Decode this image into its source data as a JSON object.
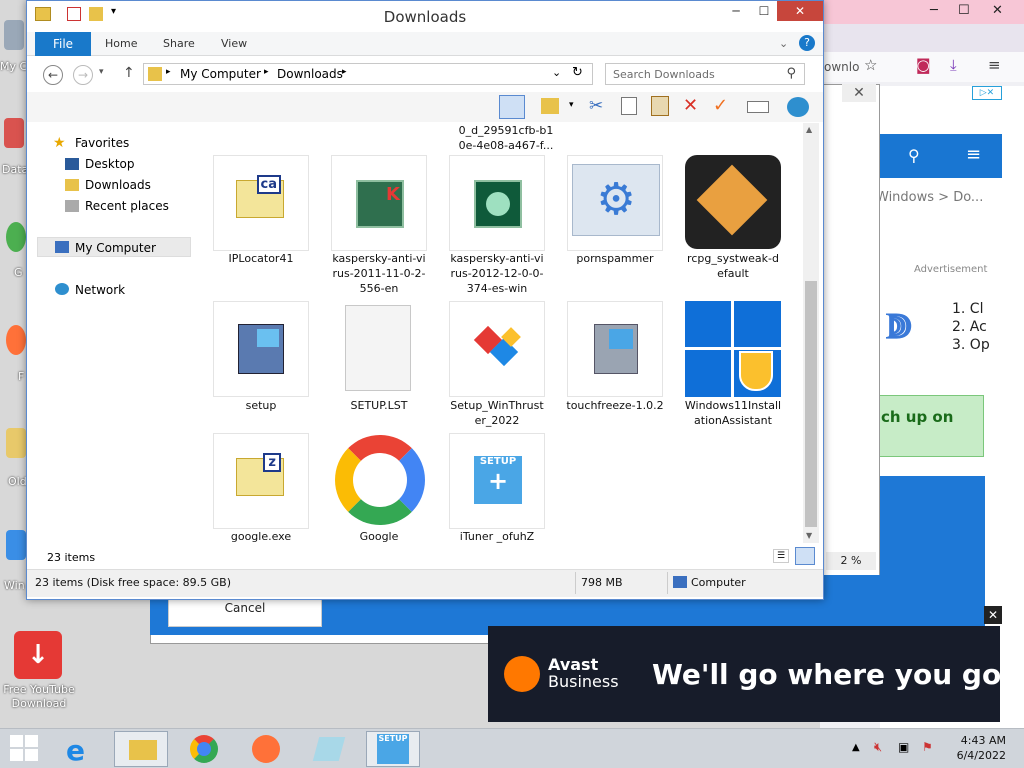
{
  "desktop": {
    "items": [
      "My C",
      "Data",
      "G\nG",
      "F",
      "Old",
      "Win"
    ],
    "youtube_label": "Free YouTube Download"
  },
  "firefox": {
    "url_fragment": "ownlo",
    "breadcrumb": "Windows > Do...",
    "ad_label": "Advertisement",
    "steps": [
      "1. Cl",
      "2. Ac",
      "3. Op"
    ],
    "green_text": "ch up on"
  },
  "dialog": {
    "cancel_label": "Cancel",
    "percent": "2 %"
  },
  "avast": {
    "brand_line1": "Avast",
    "brand_line2": "Business",
    "tagline": "We'll go where you go"
  },
  "explorer": {
    "title": "Downloads",
    "tabs": [
      "File",
      "Home",
      "Share",
      "View"
    ],
    "address": [
      "My Computer",
      "Downloads"
    ],
    "search_placeholder": "Search Downloads",
    "nav": {
      "favorites": "Favorites",
      "desktop": "Desktop",
      "downloads": "Downloads",
      "recent": "Recent places",
      "mycomputer": "My Computer",
      "network": "Network"
    },
    "partial_label": "0_d_29591cfb-b1\n0e-4e08-a467-f...",
    "files": [
      {
        "name": "IPLocator41",
        "icon": "ca-file-icon"
      },
      {
        "name": "kaspersky-anti-vi\nrus-2011-11-0-2-\n556-en",
        "icon": "kaspersky-icon"
      },
      {
        "name": "kaspersky-anti-vi\nrus-2012-12-0-0-\n374-es-win",
        "icon": "kaspersky-disc-icon"
      },
      {
        "name": "pornspammer",
        "icon": "gears-icon"
      },
      {
        "name": "rcpg_systweak-d\nefault",
        "icon": "cube-icon"
      },
      {
        "name": "setup",
        "icon": "setup-icon"
      },
      {
        "name": "SETUP.LST",
        "icon": "blank-file-icon"
      },
      {
        "name": "Setup_WinThrust\ner_2022",
        "icon": "winthruster-icon"
      },
      {
        "name": "touchfreeze-1.0.2",
        "icon": "installer-icon"
      },
      {
        "name": "Windows11Install\nationAssistant",
        "icon": "windows-shield-icon"
      },
      {
        "name": "google.exe",
        "icon": "z-file-icon"
      },
      {
        "name": "Google",
        "icon": "google-icon"
      },
      {
        "name": "iTuner _ofuhZ",
        "icon": "setup-shield-icon"
      }
    ],
    "item_count": "23 items",
    "status_disk": "23 items (Disk free space: 89.5 GB)",
    "status_size": "798 MB",
    "status_location": "Computer"
  },
  "taskbar": {
    "time": "4:43 AM",
    "date": "6/4/2022"
  }
}
